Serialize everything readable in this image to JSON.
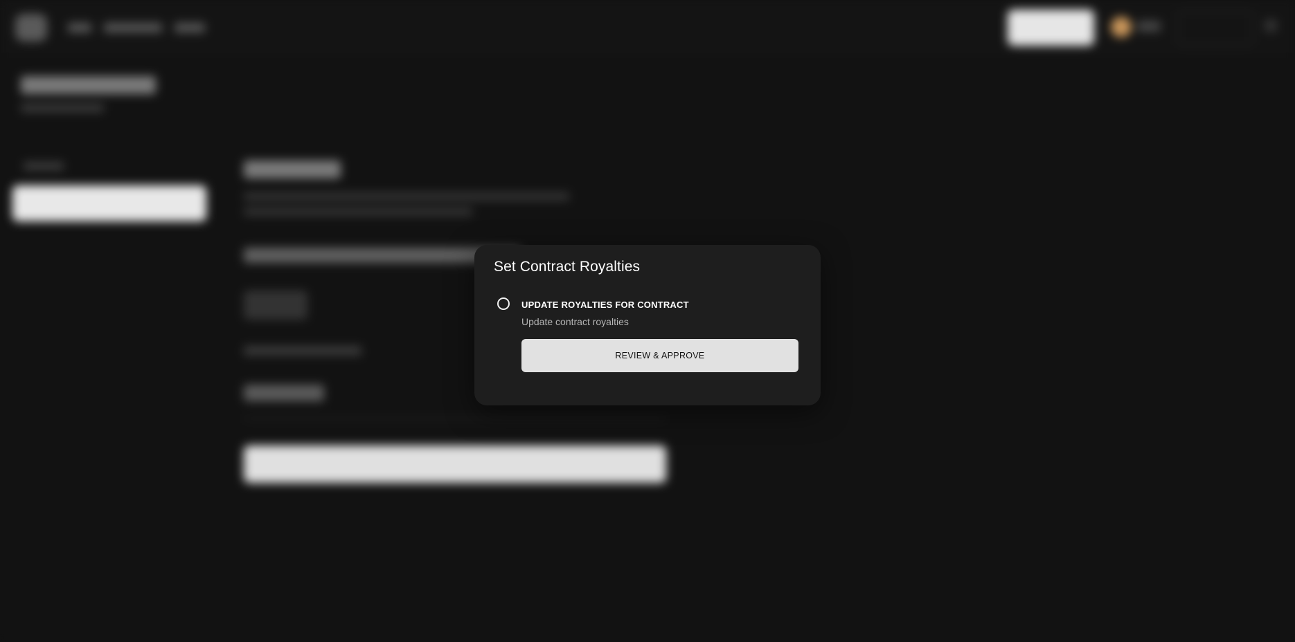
{
  "modal": {
    "title": "Set Contract Royalties",
    "step": {
      "title": "UPDATE ROYALTIES FOR CONTRACT",
      "description": "Update contract royalties",
      "button_label": "REVIEW & APPROVE",
      "status_icon": "circle-outline-icon"
    }
  },
  "colors": {
    "page_background": "#121212",
    "modal_background": "#1e1e1e",
    "button_background": "#e1e1e1",
    "avatar_accent": "#c9965a"
  }
}
